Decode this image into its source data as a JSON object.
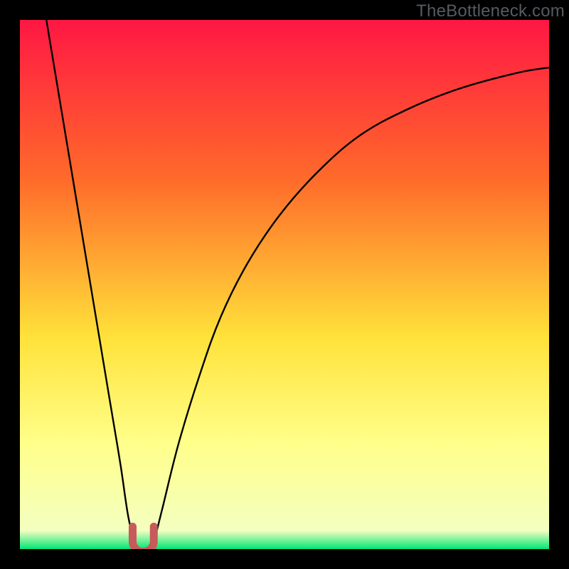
{
  "watermark": "TheBottleneck.com",
  "colors": {
    "top": "#ff1744",
    "mid_upper": "#ff6a2a",
    "mid": "#ffe23a",
    "mid_lower": "#ffff8a",
    "bottom": "#00e676",
    "curve": "#000000",
    "marker": "#c75a5a",
    "frame_bg": "#000000"
  },
  "chart_data": {
    "type": "line",
    "title": "",
    "xlabel": "",
    "ylabel": "",
    "xlim": [
      0,
      100
    ],
    "ylim": [
      0,
      100
    ],
    "grid": false,
    "legend": false,
    "series": [
      {
        "name": "left-branch",
        "x": [
          5,
          7,
          9,
          11,
          13,
          15,
          17,
          19,
          20.5,
          22
        ],
        "y": [
          100,
          88,
          76,
          64,
          52,
          40,
          28,
          16,
          6,
          0
        ]
      },
      {
        "name": "right-branch",
        "x": [
          25,
          27,
          30,
          34,
          38,
          43,
          49,
          56,
          64,
          73,
          83,
          94,
          100
        ],
        "y": [
          0,
          8,
          20,
          33,
          44,
          54,
          63,
          71,
          78,
          83,
          87,
          90,
          91
        ]
      }
    ],
    "marker": {
      "shape": "u",
      "x_center": 23.3,
      "y_center": 2.0,
      "width": 4.0,
      "height": 4.5,
      "color": "#c75a5a"
    },
    "gradient_stops": [
      {
        "pos": 0.0,
        "color": "#ff1744"
      },
      {
        "pos": 0.3,
        "color": "#ff6a2a"
      },
      {
        "pos": 0.6,
        "color": "#ffe23a"
      },
      {
        "pos": 0.8,
        "color": "#ffff8a"
      },
      {
        "pos": 0.965,
        "color": "#f4ffc0"
      },
      {
        "pos": 1.0,
        "color": "#00e676"
      }
    ]
  }
}
